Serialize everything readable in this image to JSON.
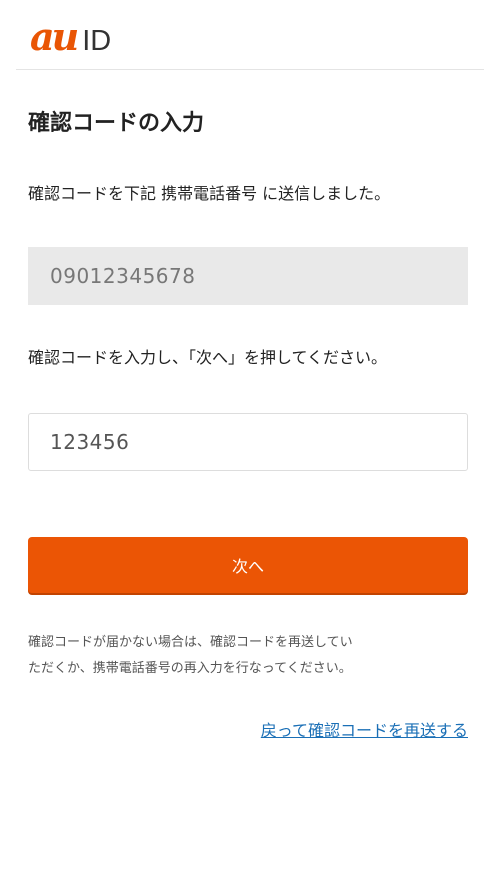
{
  "header": {
    "logo_au": "au",
    "logo_id": "ID",
    "logo_color": "#e95504"
  },
  "main": {
    "title": "確認コードの入力",
    "sent_description": "確認コードを下記 携帯電話番号 に送信しました。",
    "phone_number": "09012345678",
    "input_instruction": "確認コードを入力し、「次へ」を押してください。",
    "code_value": "123456",
    "next_button_label": "次へ",
    "note_lines": [
      "確認コードが届かない場合は、確認コードを再送してい",
      "ただくか、携帯電話番号の再入力を行なってください。"
    ],
    "resend_link": "戻って確認コードを再送する"
  },
  "colors": {
    "accent": "#eb5505",
    "link": "#1a6fb6",
    "field_background": "#e9e9e9"
  }
}
